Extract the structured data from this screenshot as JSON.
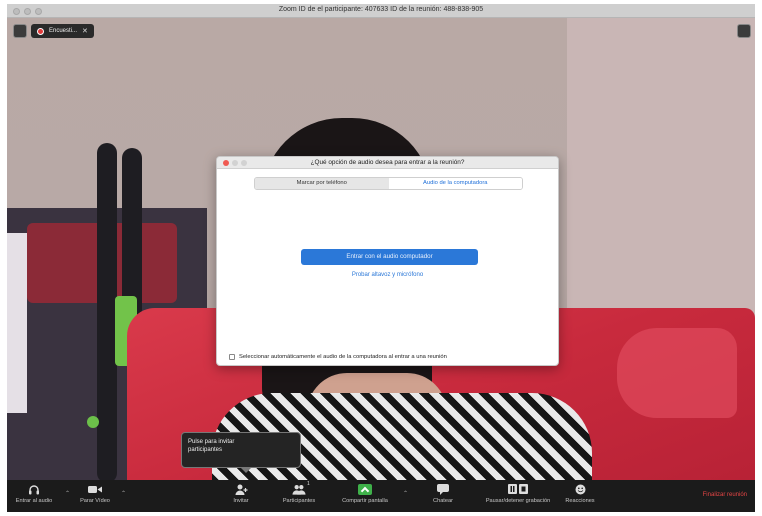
{
  "window": {
    "title": "Zoom ID de el participante: 407633  ID de la reunión: 488-838-905"
  },
  "video_overlay": {
    "talker_name": "Encuesti...",
    "talker_close": "✕"
  },
  "dialog": {
    "title": "¿Qué opción de audio desea para entrar a la reunión?",
    "tabs": [
      {
        "label": "Marcar por teléfono",
        "active": false
      },
      {
        "label": "Audio de la computadora",
        "active": true
      }
    ],
    "join_button": "Entrar con el audio computador",
    "test_link": "Probar altavoz y micrófono",
    "auto_join_label": "Seleccionar automáticamente el audio de la computadora al entrar a una reunión"
  },
  "tooltip": {
    "text": "Pulse para invitar participantes"
  },
  "toolbar": {
    "items": [
      {
        "label": "Entrar al audio",
        "icon": "headphones-icon"
      },
      {
        "label": "Parar Vídeo",
        "icon": "video-camera-icon"
      },
      {
        "label": "Invitar",
        "icon": "invite-person-icon"
      },
      {
        "label": "Participantes",
        "icon": "participants-icon",
        "count": "1"
      },
      {
        "label": "Compartir pantalla",
        "icon": "share-screen-icon"
      },
      {
        "label": "Chatear",
        "icon": "chat-bubble-icon"
      },
      {
        "label": "Pausar/detener grabación",
        "icon": "record-pause-stop-icon"
      },
      {
        "label": "Reacciones",
        "icon": "reactions-icon"
      }
    ],
    "end_label": "Finalizar reunión"
  },
  "colors": {
    "accent_blue": "#2b78d8",
    "share_green": "#3fb14a",
    "end_red": "#e64545"
  }
}
